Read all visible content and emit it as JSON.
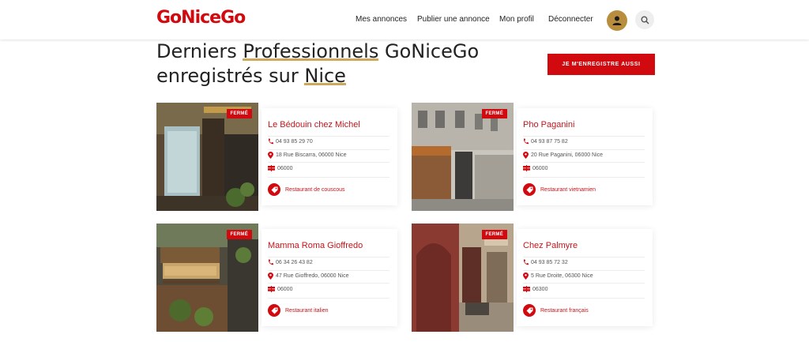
{
  "header": {
    "logo": "GoNiceGo",
    "nav": [
      "Mes annonces",
      "Publier une annonce",
      "Mon profil",
      "Déconnecter"
    ],
    "avatar_icon": "user-icon",
    "search_icon": "search-icon"
  },
  "title": {
    "part1": "Derniers ",
    "part1_hl": "Professionnels",
    "part2": " GoNiceGo",
    "part3": "enregistrés sur ",
    "part3_hl": "Nice"
  },
  "cta_label": "JE M'ENREGISTRE AUSSI",
  "colors": {
    "brand_red": "#d10a10",
    "accent_gold": "#cda85a"
  },
  "cards": [
    {
      "badge": "FERMÉ",
      "name": "Le Bédouin chez Michel",
      "phone": "04 93 85 29 70",
      "address": "18 Rue Biscarra, 06000 Nice",
      "postcode": "06000",
      "category": "Restaurant de couscous"
    },
    {
      "badge": "FERMÉ",
      "name": "Pho Paganini",
      "phone": "04 93 87 75 82",
      "address": "20 Rue Paganini, 06000 Nice",
      "postcode": "06000",
      "category": "Restaurant vietnamien"
    },
    {
      "badge": "FERMÉ",
      "name": "Mamma Roma Gioffredo",
      "phone": "06 34 26 43 82",
      "address": "47 Rue Gioffredo, 06000 Nice",
      "postcode": "06000",
      "category": "Restaurant italien"
    },
    {
      "badge": "FERMÉ",
      "name": "Chez Palmyre",
      "phone": "04 93 85 72 32",
      "address": "5 Rue Droite, 06300 Nice",
      "postcode": "06300",
      "category": "Restaurant français"
    }
  ]
}
